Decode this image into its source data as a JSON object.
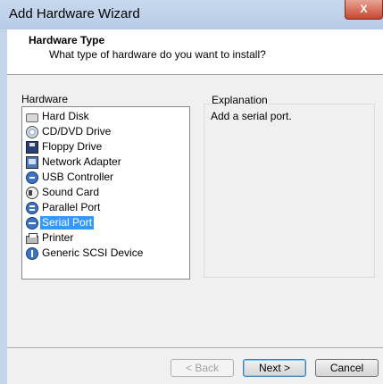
{
  "window": {
    "title": "Add Hardware Wizard",
    "close_label": "X"
  },
  "header": {
    "title": "Hardware Type",
    "subtitle": "What type of hardware do you want to install?"
  },
  "hardware": {
    "label": "Hardware",
    "selected": "Serial Port",
    "items": [
      {
        "label": "Hard Disk",
        "icon": "hard-disk-icon"
      },
      {
        "label": "CD/DVD Drive",
        "icon": "cd-dvd-icon"
      },
      {
        "label": "Floppy Drive",
        "icon": "floppy-icon"
      },
      {
        "label": "Network Adapter",
        "icon": "network-adapter-icon"
      },
      {
        "label": "USB Controller",
        "icon": "usb-icon"
      },
      {
        "label": "Sound Card",
        "icon": "sound-card-icon"
      },
      {
        "label": "Parallel Port",
        "icon": "parallel-port-icon"
      },
      {
        "label": "Serial Port",
        "icon": "serial-port-icon"
      },
      {
        "label": "Printer",
        "icon": "printer-icon"
      },
      {
        "label": "Generic SCSI Device",
        "icon": "scsi-device-icon"
      }
    ]
  },
  "explanation": {
    "label": "Explanation",
    "text": "Add a serial port."
  },
  "buttons": {
    "back": "< Back",
    "next": "Next >",
    "cancel": "Cancel"
  },
  "colors": {
    "selection": "#3399ff",
    "titlebar": "#b9cde8",
    "close": "#c7462f"
  }
}
